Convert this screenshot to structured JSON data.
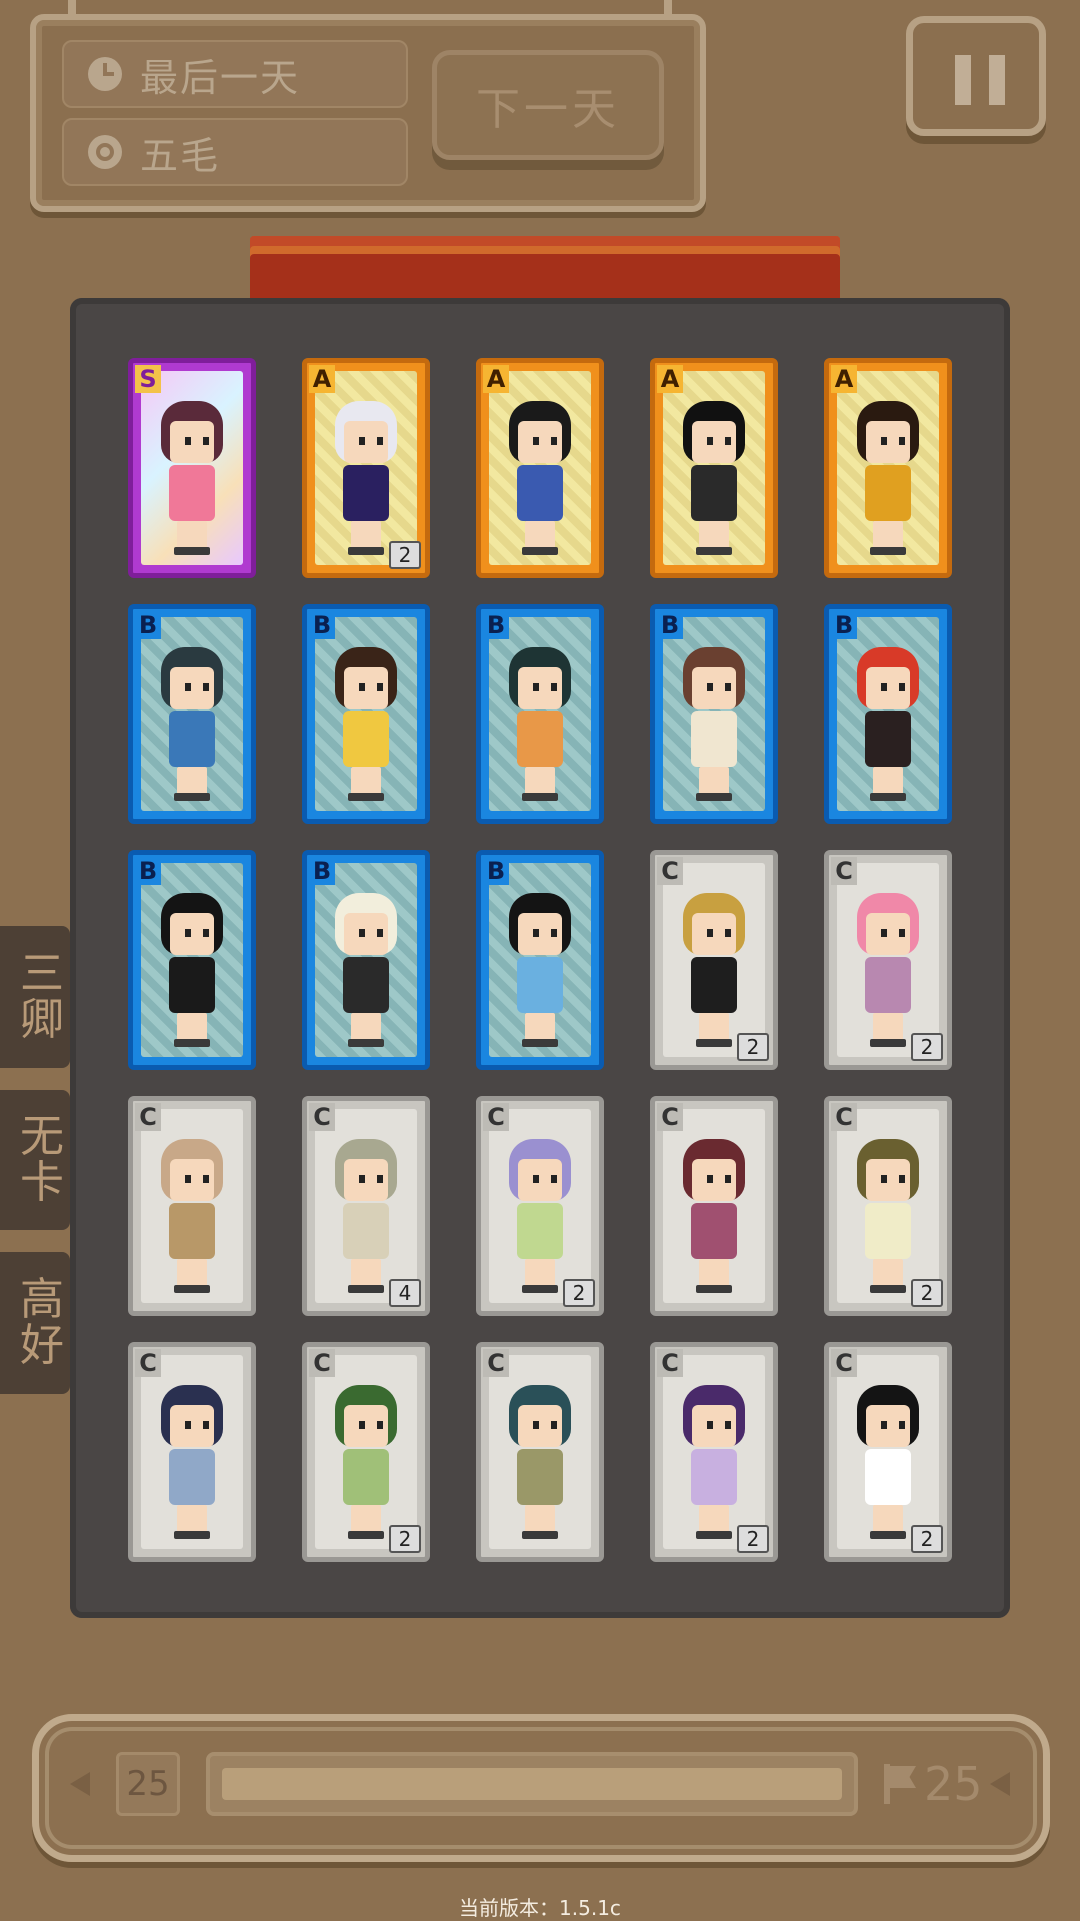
{
  "hud": {
    "day_text": "最后一天",
    "money_text": "五毛",
    "next_day_label": "下一天",
    "icons": {
      "day": "clock-icon",
      "money": "coin-icon",
      "pause": "pause-icon"
    }
  },
  "side_tabs": [
    {
      "label": "三\n卿"
    },
    {
      "label": "无\n卡"
    },
    {
      "label": "高\n好"
    }
  ],
  "cards": [
    {
      "grade": "S",
      "count": "",
      "hair": "#5a2a3a",
      "outfit": "#f07898"
    },
    {
      "grade": "A",
      "count": "2",
      "hair": "#e8e8f0",
      "outfit": "#2a2060"
    },
    {
      "grade": "A",
      "count": "",
      "hair": "#1a1a1a",
      "outfit": "#3a5ab0"
    },
    {
      "grade": "A",
      "count": "",
      "hair": "#111111",
      "outfit": "#2a2a2a"
    },
    {
      "grade": "A",
      "count": "",
      "hair": "#2a1a10",
      "outfit": "#e0a020"
    },
    {
      "grade": "B",
      "count": "",
      "hair": "#2a3a40",
      "outfit": "#3a78b8"
    },
    {
      "grade": "B",
      "count": "",
      "hair": "#3a2418",
      "outfit": "#f0c840"
    },
    {
      "grade": "B",
      "count": "",
      "hair": "#1e3434",
      "outfit": "#e89848"
    },
    {
      "grade": "B",
      "count": "",
      "hair": "#6a4030",
      "outfit": "#f0e6d0"
    },
    {
      "grade": "B",
      "count": "",
      "hair": "#d83a28",
      "outfit": "#2a2020"
    },
    {
      "grade": "B",
      "count": "",
      "hair": "#141414",
      "outfit": "#1a1a1a"
    },
    {
      "grade": "B",
      "count": "",
      "hair": "#f2eedc",
      "outfit": "#2a2a2a"
    },
    {
      "grade": "B",
      "count": "",
      "hair": "#141414",
      "outfit": "#6ab0e0"
    },
    {
      "grade": "C",
      "count": "2",
      "hair": "#c8a040",
      "outfit": "#1e1e1e"
    },
    {
      "grade": "C",
      "count": "2",
      "hair": "#f088a8",
      "outfit": "#b888b0"
    },
    {
      "grade": "C",
      "count": "",
      "hair": "#c8a888",
      "outfit": "#b89868"
    },
    {
      "grade": "C",
      "count": "4",
      "hair": "#a8a890",
      "outfit": "#d8d0b8"
    },
    {
      "grade": "C",
      "count": "2",
      "hair": "#9a90d0",
      "outfit": "#c0d890"
    },
    {
      "grade": "C",
      "count": "",
      "hair": "#6a2a30",
      "outfit": "#a05070"
    },
    {
      "grade": "C",
      "count": "2",
      "hair": "#6a6030",
      "outfit": "#f0ecc8"
    },
    {
      "grade": "C",
      "count": "",
      "hair": "#2a3050",
      "outfit": "#90a8c8"
    },
    {
      "grade": "C",
      "count": "2",
      "hair": "#3a6a30",
      "outfit": "#a0c078"
    },
    {
      "grade": "C",
      "count": "",
      "hair": "#2a5058",
      "outfit": "#9a9868"
    },
    {
      "grade": "C",
      "count": "2",
      "hair": "#4a2a6a",
      "outfit": "#c8b0e0"
    },
    {
      "grade": "C",
      "count": "2",
      "hair": "#141414",
      "outfit": "#ffffff"
    }
  ],
  "pagination": {
    "current_page": "25",
    "total_label": "25",
    "progress": 1.0,
    "icons": {
      "prev": "left-arrow-icon",
      "next": "right-arrow-icon",
      "flag": "flag-icon"
    }
  },
  "version_text": "当前版本：1.5.1c",
  "colors": {
    "background": "#8c7050",
    "album": "#4a4645",
    "rarity_S": "#b03ad0",
    "rarity_A": "#f0901c",
    "rarity_B": "#1a86e0",
    "rarity_C": "#c8c6c0"
  }
}
